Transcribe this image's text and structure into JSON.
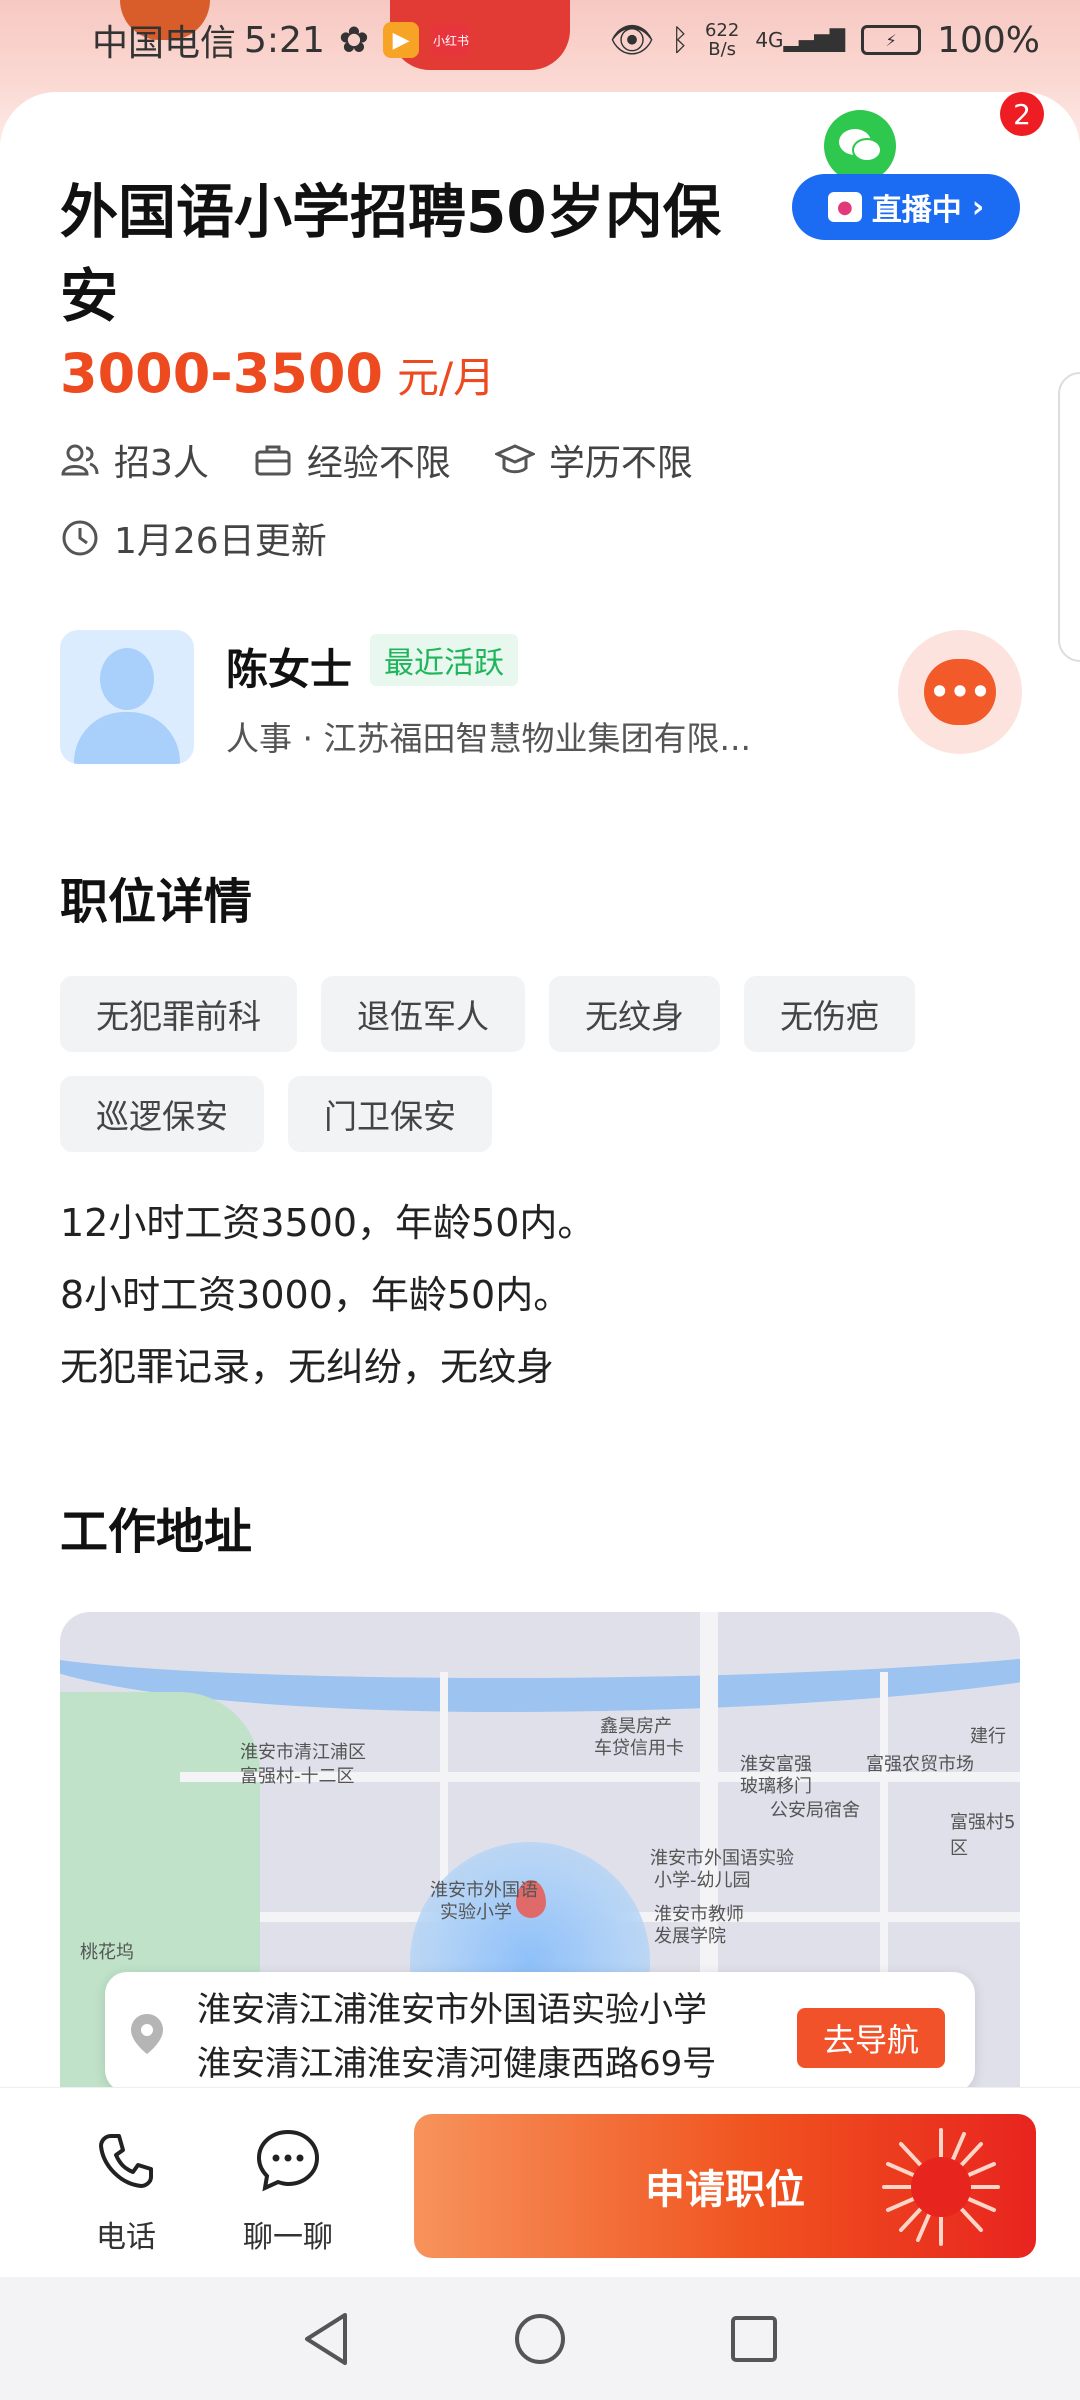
{
  "status_bar": {
    "carrier": "中国电信",
    "time": "5:21",
    "net_speed": "622\nB/s",
    "network": "4G",
    "battery": "100%",
    "app_badge": "小红书"
  },
  "job": {
    "title": "外国语小学招聘50岁内保安",
    "salary": "3000-3500",
    "salary_unit": "元/月",
    "headcount": "招3人",
    "experience": "经验不限",
    "education": "学历不限",
    "updated": "1月26日更新"
  },
  "badges": {
    "notification_count": "2",
    "live_label": "直播中"
  },
  "recruiter": {
    "name": "陈女士",
    "status": "最近活跃",
    "role_company": "人事 · 江苏福田智慧物业集团有限..."
  },
  "details": {
    "section_title": "职位详情",
    "tags": [
      "无犯罪前科",
      "退伍军人",
      "无纹身",
      "无伤疤",
      "巡逻保安",
      "门卫保安"
    ],
    "description": [
      "12小时工资3500，年龄50内。",
      "8小时工资3000，年龄50内。",
      "无犯罪记录，无纠纷，无纹身"
    ]
  },
  "address": {
    "section_title": "工作地址",
    "line1": "淮安清江浦淮安市外国语实验小学",
    "line2": "淮安清江浦淮安清河健康西路69号",
    "nav_label": "去导航",
    "map_labels": [
      "淮安市清江浦区",
      "富强村-十二区",
      "鑫昊房产",
      "车贷信用卡",
      "淮安富强",
      "玻璃移门",
      "富强农贸市场",
      "公安局宿舍",
      "富强村5区",
      "淮安市外国语实验",
      "小学-幼儿园",
      "淮安市外国语",
      "实验小学",
      "淮安市教师",
      "发展学院",
      "桃花坞",
      "建行"
    ]
  },
  "bottom_bar": {
    "phone_label": "电话",
    "chat_label": "聊一聊",
    "apply_label": "申请职位"
  },
  "colors": {
    "accent": "#ee4a1f",
    "apply_gradient_start": "#f7935c",
    "apply_gradient_end": "#e8241f",
    "live_blue": "#1b6cf2",
    "active_green": "#1fb55a"
  }
}
